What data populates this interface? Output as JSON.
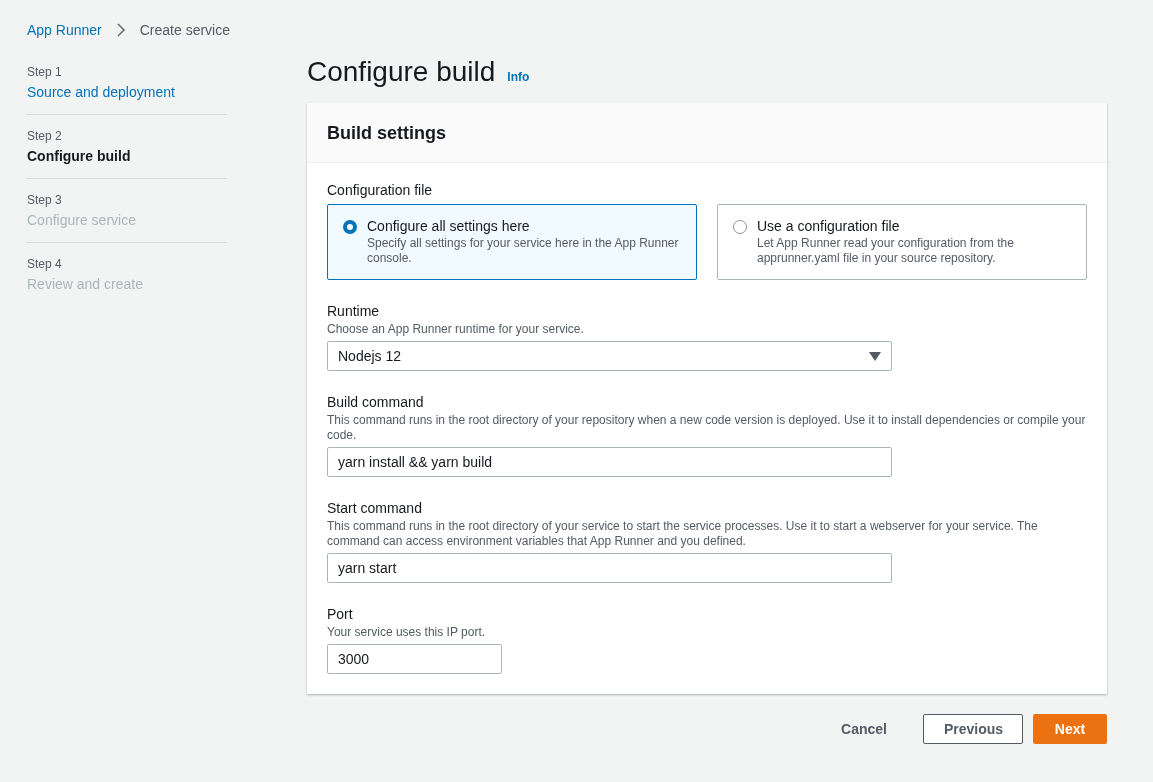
{
  "breadcrumb": [
    {
      "label": "App Runner",
      "link": true
    },
    {
      "label": "Create service",
      "link": false
    }
  ],
  "steps": [
    {
      "step": "Step 1",
      "label": "Source and deployment",
      "kind": "completed"
    },
    {
      "step": "Step 2",
      "label": "Configure build",
      "kind": "current"
    },
    {
      "step": "Step 3",
      "label": "Configure service",
      "kind": "upcoming"
    },
    {
      "step": "Step 4",
      "label": "Review and create",
      "kind": "upcoming"
    }
  ],
  "page_title": "Configure build",
  "info": "Info",
  "panel": {
    "title": "Build settings",
    "configuration_file": {
      "label": "Configuration file",
      "options": [
        {
          "title": "Configure all settings here",
          "description": "Specify all settings for your service here in the App Runner console.",
          "selected": true
        },
        {
          "title": "Use a configuration file",
          "description": "Let App Runner read your configuration from the apprunner.yaml file in your source repository.",
          "selected": false
        }
      ]
    },
    "fields": [
      {
        "kind": "select",
        "label": "Runtime",
        "description": "Choose an App Runner runtime for your service.",
        "value": "Nodejs 12"
      },
      {
        "kind": "input",
        "label": "Build command",
        "description": "This command runs in the root directory of your repository when a new code version is deployed. Use it to install dependencies or compile your code.",
        "value": "yarn install && yarn build"
      },
      {
        "kind": "input",
        "label": "Start command",
        "description": "This command runs in the root directory of your service to start the service processes. Use it to start a webserver for your service. The command can access environment variables that App Runner and you defined.",
        "value": "yarn start"
      },
      {
        "kind": "short-input",
        "label": "Port",
        "description": "Your service uses this IP port.",
        "value": "3000"
      }
    ]
  },
  "buttons": [
    {
      "label": "Cancel",
      "kind": "link"
    },
    {
      "label": "Previous",
      "kind": "secondary"
    },
    {
      "label": "Next",
      "kind": "primary"
    }
  ]
}
